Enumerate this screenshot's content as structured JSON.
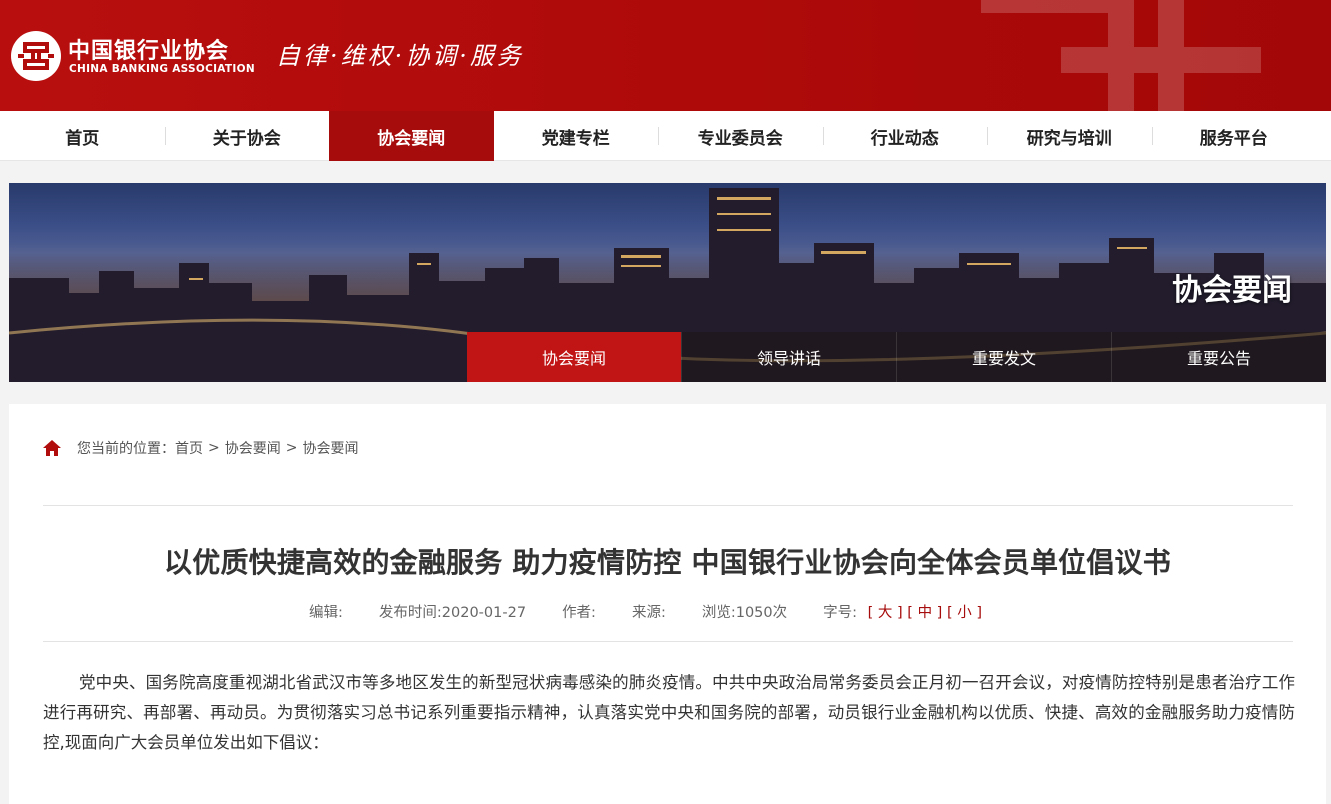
{
  "header": {
    "logo_cn": "中国银行业协会",
    "logo_en": "CHINA BANKING ASSOCIATION",
    "slogan": "自律·维权·协调·服务",
    "brand_color": "#ae0a0a"
  },
  "nav": {
    "items": [
      {
        "label": "首页"
      },
      {
        "label": "关于协会"
      },
      {
        "label": "协会要闻"
      },
      {
        "label": "党建专栏"
      },
      {
        "label": "专业委员会"
      },
      {
        "label": "行业动态"
      },
      {
        "label": "研究与培训"
      },
      {
        "label": "服务平台"
      }
    ],
    "active_index": 2
  },
  "banner": {
    "title": "协会要闻",
    "subnav": [
      {
        "label": "协会要闻"
      },
      {
        "label": "领导讲话"
      },
      {
        "label": "重要发文"
      },
      {
        "label": "重要公告"
      }
    ],
    "active_index": 0
  },
  "breadcrumb": {
    "prefix": "您当前的位置：",
    "items": [
      "首页",
      "协会要闻",
      "协会要闻"
    ],
    "separator": ">"
  },
  "article": {
    "title": "以优质快捷高效的金融服务 助力疫情防控 中国银行业协会向全体会员单位倡议书",
    "editor_label": "编辑:",
    "publish_label": "发布时间:",
    "publish_date": "2020-01-27",
    "author_label": "作者:",
    "source_label": "来源:",
    "views_label": "浏览:",
    "views_value": "1050次",
    "font_size_label": "字号:",
    "font_sizes": [
      "[ 大 ]",
      "[ 中 ]",
      "[ 小 ]"
    ],
    "body": "党中央、国务院高度重视湖北省武汉市等多地区发生的新型冠状病毒感染的肺炎疫情。中共中央政治局常务委员会正月初一召开会议，对疫情防控特别是患者治疗工作进行再研究、再部署、再动员。为贯彻落实习总书记系列重要指示精神，认真落实党中央和国务院的部署，动员银行业金融机构以优质、快捷、高效的金融服务助力疫情防控,现面向广大会员单位发出如下倡议："
  }
}
